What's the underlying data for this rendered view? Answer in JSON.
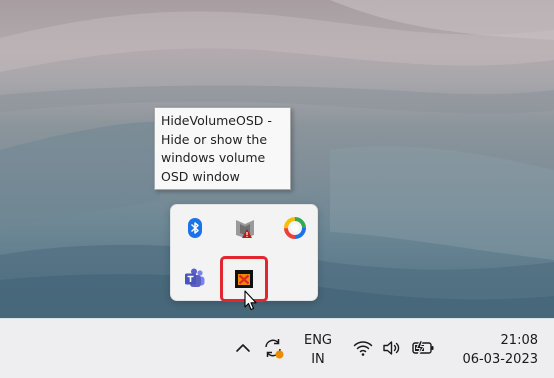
{
  "tooltip": {
    "text": "HideVolumeOSD -\nHide or show the\nwindows volume\nOSD window"
  },
  "tray_flyout": {
    "icons": [
      {
        "name": "bluetooth-icon",
        "color": "#1a73e8"
      },
      {
        "name": "mcafee-icon",
        "color": "#c01818"
      },
      {
        "name": "google-drive-icon",
        "color": "#1a73e8"
      },
      {
        "name": "teams-icon",
        "color": "#5b5fc7"
      },
      {
        "name": "hidevolumeosd-icon",
        "color": "#e2262f"
      }
    ],
    "selected_highlight_color": "#e2262f"
  },
  "taskbar": {
    "show_hidden_icons": "chevron-up-icon",
    "sync_icon": "sync-icon",
    "language_line1": "ENG",
    "language_line2": "IN",
    "wifi_icon": "wifi-icon",
    "volume_icon": "volume-icon",
    "battery_icon": "battery-charging-icon",
    "time": "21:08",
    "date": "06-03-2023"
  },
  "colors": {
    "taskbar_bg": "#eeeef0",
    "tooltip_bg": "#f8f8f8",
    "accent_orange": "#f08a00"
  }
}
